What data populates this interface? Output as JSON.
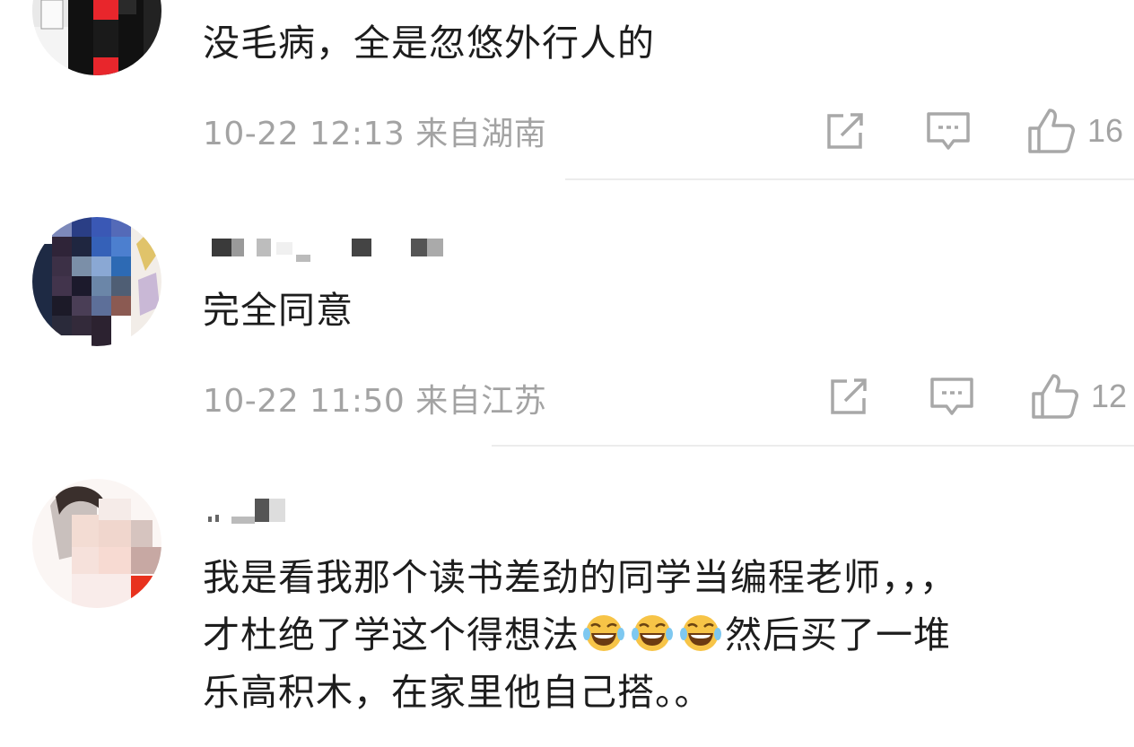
{
  "comments": [
    {
      "text": "没毛病，全是忽悠外行人的",
      "date": "10-22 12:13",
      "location": "来自湖南",
      "likes": "16"
    },
    {
      "text": "完全同意",
      "date": "10-22 11:50",
      "location": "来自江苏",
      "likes": "12"
    },
    {
      "line1": "我是看我那个读书差劲的同学当编程老师，，，",
      "line2a": "才杜绝了学这个得想法",
      "line2b": "然后买了一堆",
      "line3": "乐高积木，在家里他自己搭。。"
    }
  ],
  "icons": {
    "repost": "repost-icon",
    "comment": "comment-icon",
    "like": "thumbs-up-icon",
    "emoji": "laughing-tears-emoji"
  },
  "colors": {
    "text": "#1d1d1d",
    "meta": "#a3a3a3",
    "divider": "#ececec"
  }
}
